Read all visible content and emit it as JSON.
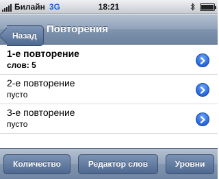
{
  "status_bar": {
    "carrier": "Билайн",
    "network": "3G",
    "time": "18:21",
    "icons": [
      "signal-icon",
      "bluetooth-icon",
      "battery-icon"
    ]
  },
  "nav": {
    "back_label": "Назад",
    "title": "Повторения"
  },
  "rows": [
    {
      "title": "1-е повторение",
      "subtitle": "слов: 5"
    },
    {
      "title": "2-е повторение",
      "subtitle": "пусто"
    },
    {
      "title": "3-е повторение",
      "subtitle": "пусто"
    }
  ],
  "toolbar": {
    "count_label": "Количество",
    "editor_label": "Редактор слов",
    "levels_label": "Уровни"
  },
  "colors": {
    "nav_bar": "#8fa1b9",
    "network_text": "#1d5fd6",
    "disclosure": "#2d6ee0"
  }
}
